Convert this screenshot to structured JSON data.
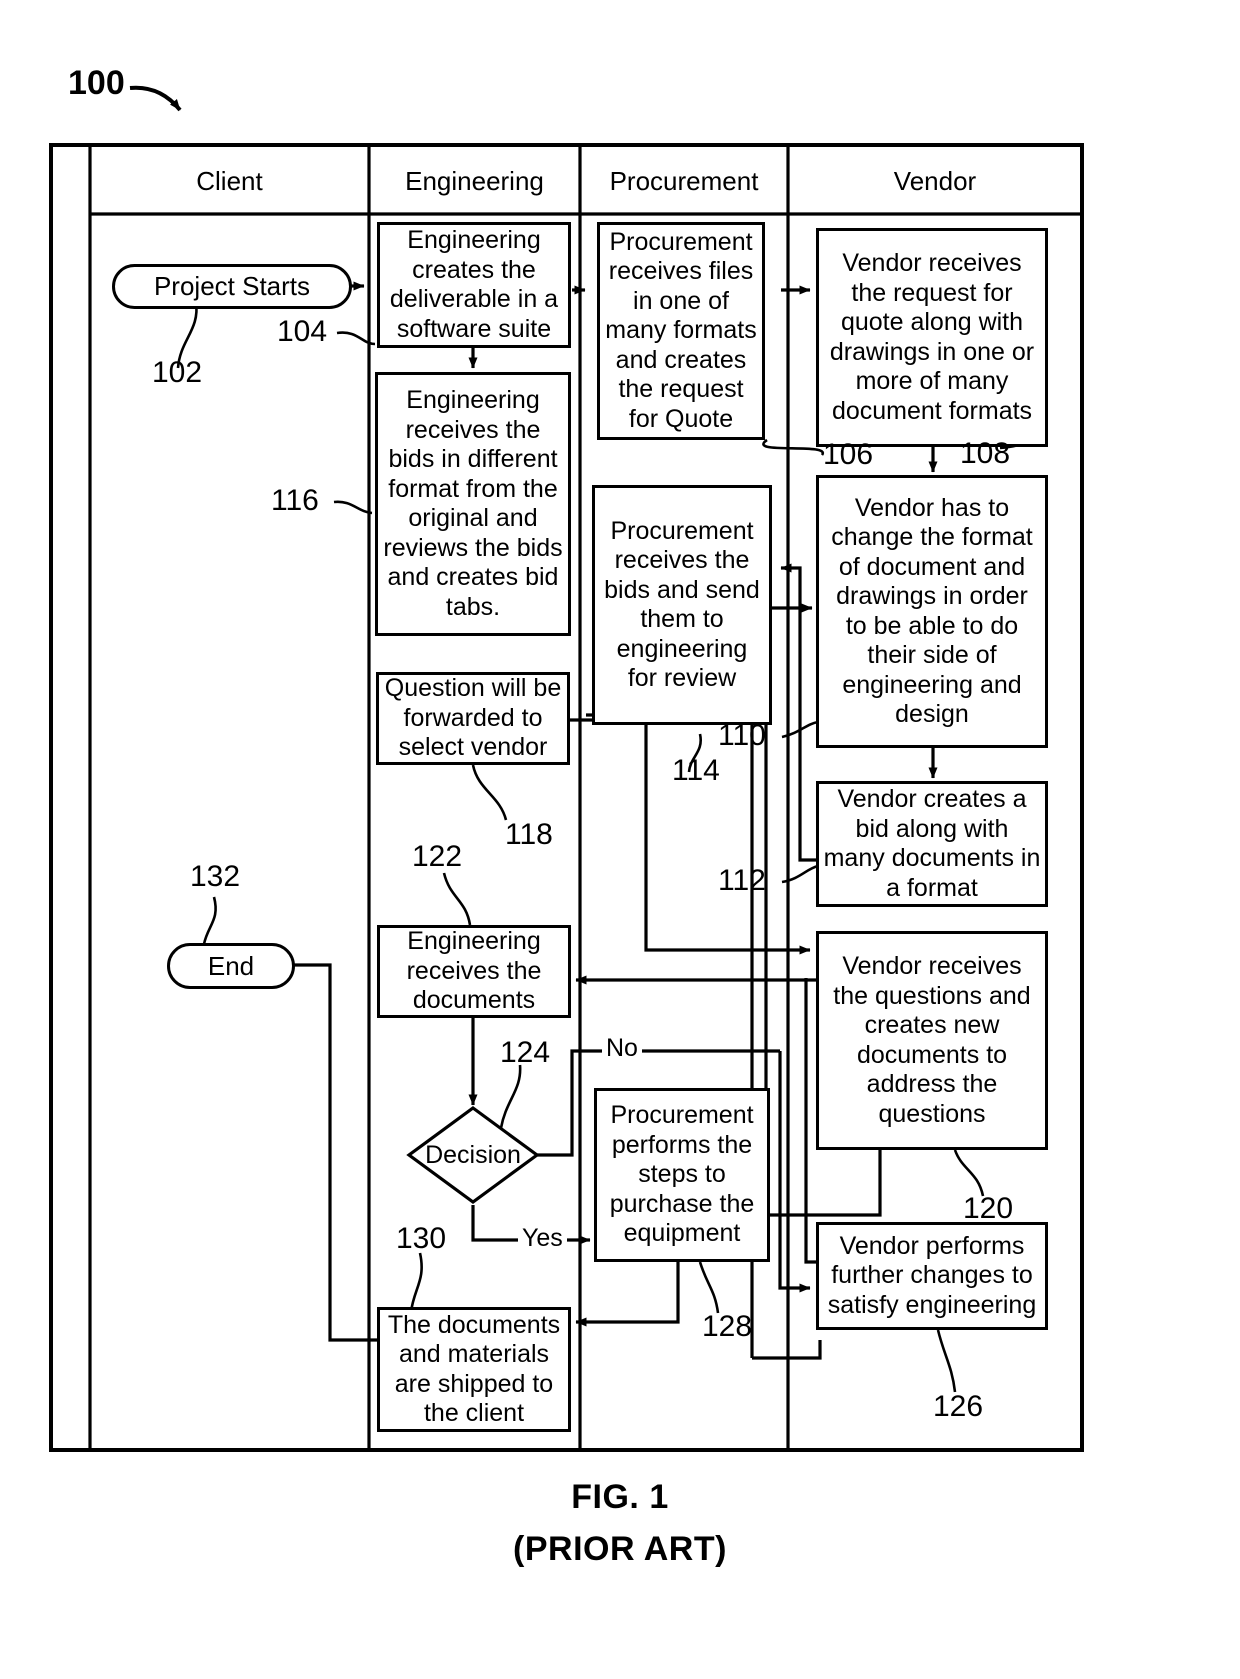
{
  "figure": {
    "diagram_numeral": "100",
    "caption_line1": "FIG. 1",
    "caption_line2": "(PRIOR ART)",
    "line_color": "#000000",
    "background_color": "#ffffff"
  },
  "lanes": [
    {
      "id": "lane-gutter",
      "label": ""
    },
    {
      "id": "lane-client",
      "label": "Client"
    },
    {
      "id": "lane-engineering",
      "label": "Engineering"
    },
    {
      "id": "lane-procurement",
      "label": "Procurement"
    },
    {
      "id": "lane-vendor",
      "label": "Vendor"
    }
  ],
  "nodes": {
    "project_starts": {
      "label": "Project Starts",
      "ref": "102",
      "lane": "Client",
      "shape": "terminator"
    },
    "eng_creates": {
      "label": "Engineering creates the deliverable in a software suite",
      "ref": "104",
      "lane": "Engineering",
      "shape": "process"
    },
    "proc_receives_files": {
      "label": "Procurement receives files in one of many formats and creates the request for Quote",
      "ref": "106",
      "lane": "Procurement",
      "shape": "process"
    },
    "vendor_receives_rfq": {
      "label": "Vendor receives the request for quote along with drawings in one or more of many document formats",
      "ref": "108",
      "lane": "Vendor",
      "shape": "process"
    },
    "vendor_change_format": {
      "label": "Vendor has to change the format of document and drawings in order to be able to do their side of engineering and design",
      "ref": "110",
      "lane": "Vendor",
      "shape": "process"
    },
    "vendor_creates_bid": {
      "label": "Vendor creates a bid along with many documents in a format",
      "ref": "112",
      "lane": "Vendor",
      "shape": "process"
    },
    "proc_receives_bids": {
      "label": "Procurement receives the bids and send them to engineering for review",
      "ref": "114",
      "lane": "Procurement",
      "shape": "process"
    },
    "eng_receives_bids": {
      "label": "Engineering receives the bids in different format from the original and reviews the bids and creates bid tabs.",
      "ref": "116",
      "lane": "Engineering",
      "shape": "process"
    },
    "question_forwarded": {
      "label": "Question will be forwarded to select vendor",
      "ref": "118",
      "lane": "Engineering",
      "shape": "process"
    },
    "vendor_receives_questions": {
      "label": "Vendor receives the questions and creates new documents to address the questions",
      "ref": "120",
      "lane": "Vendor",
      "shape": "process"
    },
    "eng_receives_docs": {
      "label": "Engineering receives the documents",
      "ref": "122",
      "lane": "Engineering",
      "shape": "process"
    },
    "decision": {
      "label": "Decision",
      "ref": "124",
      "lane": "Engineering",
      "shape": "decision"
    },
    "vendor_further_changes": {
      "label": "Vendor performs further changes to satisfy engineering",
      "ref": "126",
      "lane": "Vendor",
      "shape": "process"
    },
    "proc_purchase": {
      "label": "Procurement performs the steps to purchase the equipment",
      "ref": "128",
      "lane": "Procurement",
      "shape": "process"
    },
    "docs_shipped": {
      "label": "The documents and materials are shipped to the client",
      "ref": "130",
      "lane": "Engineering",
      "shape": "process"
    },
    "end": {
      "label": "End",
      "ref": "132",
      "lane": "Client",
      "shape": "terminator"
    }
  },
  "branch_labels": {
    "no": "No",
    "yes": "Yes"
  },
  "reference_numerals": [
    "100",
    "102",
    "104",
    "106",
    "108",
    "110",
    "112",
    "114",
    "116",
    "118",
    "120",
    "122",
    "124",
    "126",
    "128",
    "130",
    "132"
  ]
}
